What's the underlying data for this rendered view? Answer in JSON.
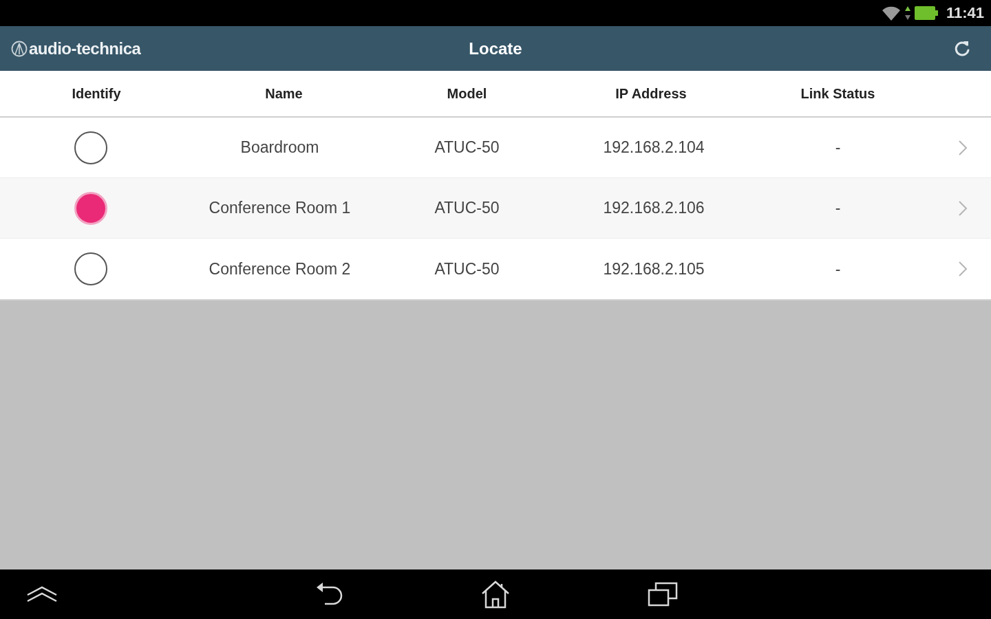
{
  "status_bar": {
    "time": "11:41"
  },
  "app_bar": {
    "logo": "audio-technica",
    "title": "Locate"
  },
  "table": {
    "columns": [
      "Identify",
      "Name",
      "Model",
      "IP Address",
      "Link Status"
    ],
    "rows": [
      {
        "identify_on": false,
        "name": "Boardroom",
        "model": "ATUC-50",
        "ip_address": "192.168.2.104",
        "link_status": "-"
      },
      {
        "identify_on": true,
        "name": "Conference Room 1",
        "model": "ATUC-50",
        "ip_address": "192.168.2.106",
        "link_status": "-"
      },
      {
        "identify_on": false,
        "name": "Conference Room 2",
        "model": "ATUC-50",
        "ip_address": "192.168.2.105",
        "link_status": "-"
      }
    ]
  }
}
